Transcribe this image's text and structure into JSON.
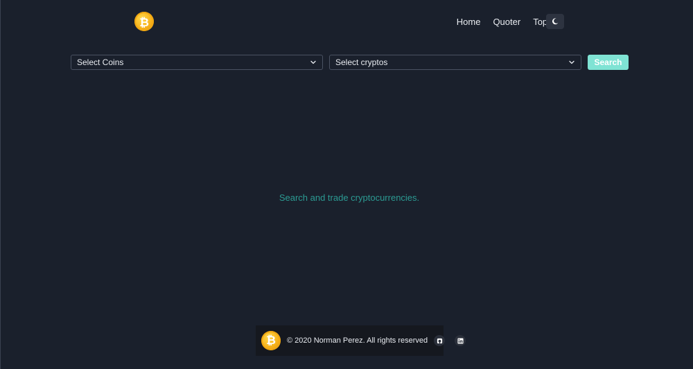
{
  "header": {
    "logo_symbol": "₿",
    "nav": [
      {
        "label": "Home"
      },
      {
        "label": "Quoter"
      },
      {
        "label": "Top List"
      }
    ],
    "theme_icon": "moon-icon"
  },
  "search": {
    "coins_select": {
      "value": "Select Coins"
    },
    "cryptos_select": {
      "value": "Select cryptos"
    },
    "button_label": "Search"
  },
  "main": {
    "tagline": "Search and trade cryptocurrencies."
  },
  "footer": {
    "logo_symbol": "₿",
    "copyright": "© 2020 Norman Perez. All rights reserved",
    "icons": [
      "github-icon",
      "linkedin-icon"
    ]
  },
  "colors": {
    "background": "#1a202c",
    "accent": "#7fe3d4",
    "tagline": "#2c9b93",
    "footer_bg": "#15181f",
    "bitcoin": "#f7b21b"
  }
}
